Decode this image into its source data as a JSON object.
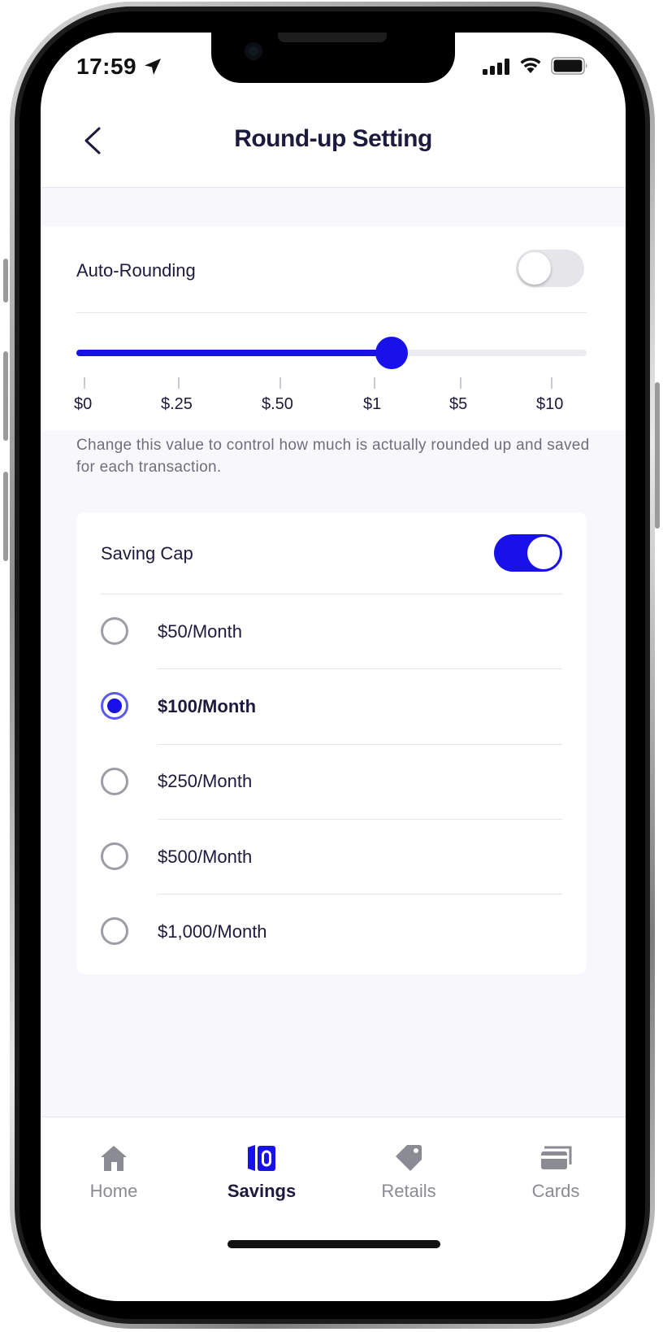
{
  "status_bar": {
    "time": "17:59"
  },
  "header": {
    "title": "Round-up Setting",
    "back_icon": "chevron-left-icon"
  },
  "auto_rounding": {
    "label": "Auto-Rounding",
    "enabled": false,
    "slider_ticks": [
      "$0",
      "$.25",
      "$.50",
      "$1",
      "$5",
      "$10"
    ],
    "selected_value": "$1",
    "help_text": "Change this value to control how much is actually rounded up and saved for each transaction."
  },
  "saving_cap": {
    "label": "Saving Cap",
    "enabled": true,
    "options": [
      "$50/Month",
      "$100/Month",
      "$250/Month",
      "$500/Month",
      "$1,000/Month"
    ],
    "selected": "$100/Month"
  },
  "tab_bar": {
    "tabs": [
      {
        "label": "Home",
        "icon": "house-icon"
      },
      {
        "label": "Savings",
        "icon": "savings-icon"
      },
      {
        "label": "Retails",
        "icon": "tag-icon"
      },
      {
        "label": "Cards",
        "icon": "cards-icon"
      }
    ],
    "active": "Savings"
  },
  "colors": {
    "accent": "#1912e8",
    "text": "#1c1a3d",
    "muted": "#8b8b93",
    "background": "#f8f8fc"
  }
}
